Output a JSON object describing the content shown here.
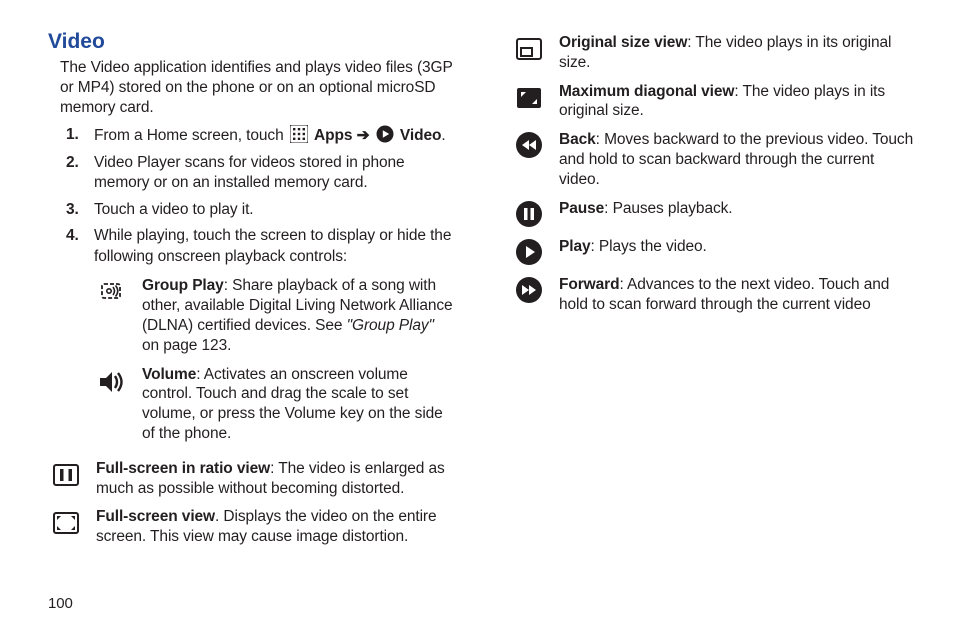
{
  "heading": "Video",
  "intro": "The Video application identifies and plays video files (3GP or MP4) stored on the phone or on an optional microSD memory card.",
  "steps": {
    "s1_prefix": "From a Home screen, touch ",
    "s1_apps": " Apps ",
    "s1_arrow": "➔",
    "s1_video": " Video",
    "s1_suffix": ".",
    "s2": "Video Player scans for videos stored in phone memory or on an installed memory card.",
    "s3": "Touch a video to play it.",
    "s4": "While playing, touch the screen to display or hide the following onscreen playback controls:"
  },
  "controls": {
    "groupplay_title": "Group Play",
    "groupplay_body": ": Share playback of a song with other, available Digital Living Network Alliance (DLNA) certified devices. See ",
    "groupplay_ref": "\"Group Play\"",
    "groupplay_tail": " on page 123.",
    "volume_title": "Volume",
    "volume_body": ": Activates an onscreen volume control. Touch and drag the scale to set volume, or press the Volume key on the side of the phone.",
    "ratio_title": "Full-screen in ratio view",
    "ratio_body": ": The video is enlarged as much as possible without becoming distorted.",
    "full_title": "Full-screen view",
    "full_body": ". Displays the video on the entire screen. This view may cause image distortion.",
    "orig_title": "Original size view",
    "orig_body": ": The video plays in its original size.",
    "maxdiag_title": "Maximum diagonal view",
    "maxdiag_body": ": The video plays in its original size.",
    "back_title": "Back",
    "back_body": ": Moves backward to the previous video. Touch and hold to scan backward through the current video.",
    "pause_title": "Pause",
    "pause_body": ": Pauses playback.",
    "play_title": "Play",
    "play_body": ": Plays the video.",
    "fwd_title": "Forward",
    "fwd_body": ": Advances to the next video. Touch and hold to scan forward through the current video"
  },
  "footer": "100"
}
